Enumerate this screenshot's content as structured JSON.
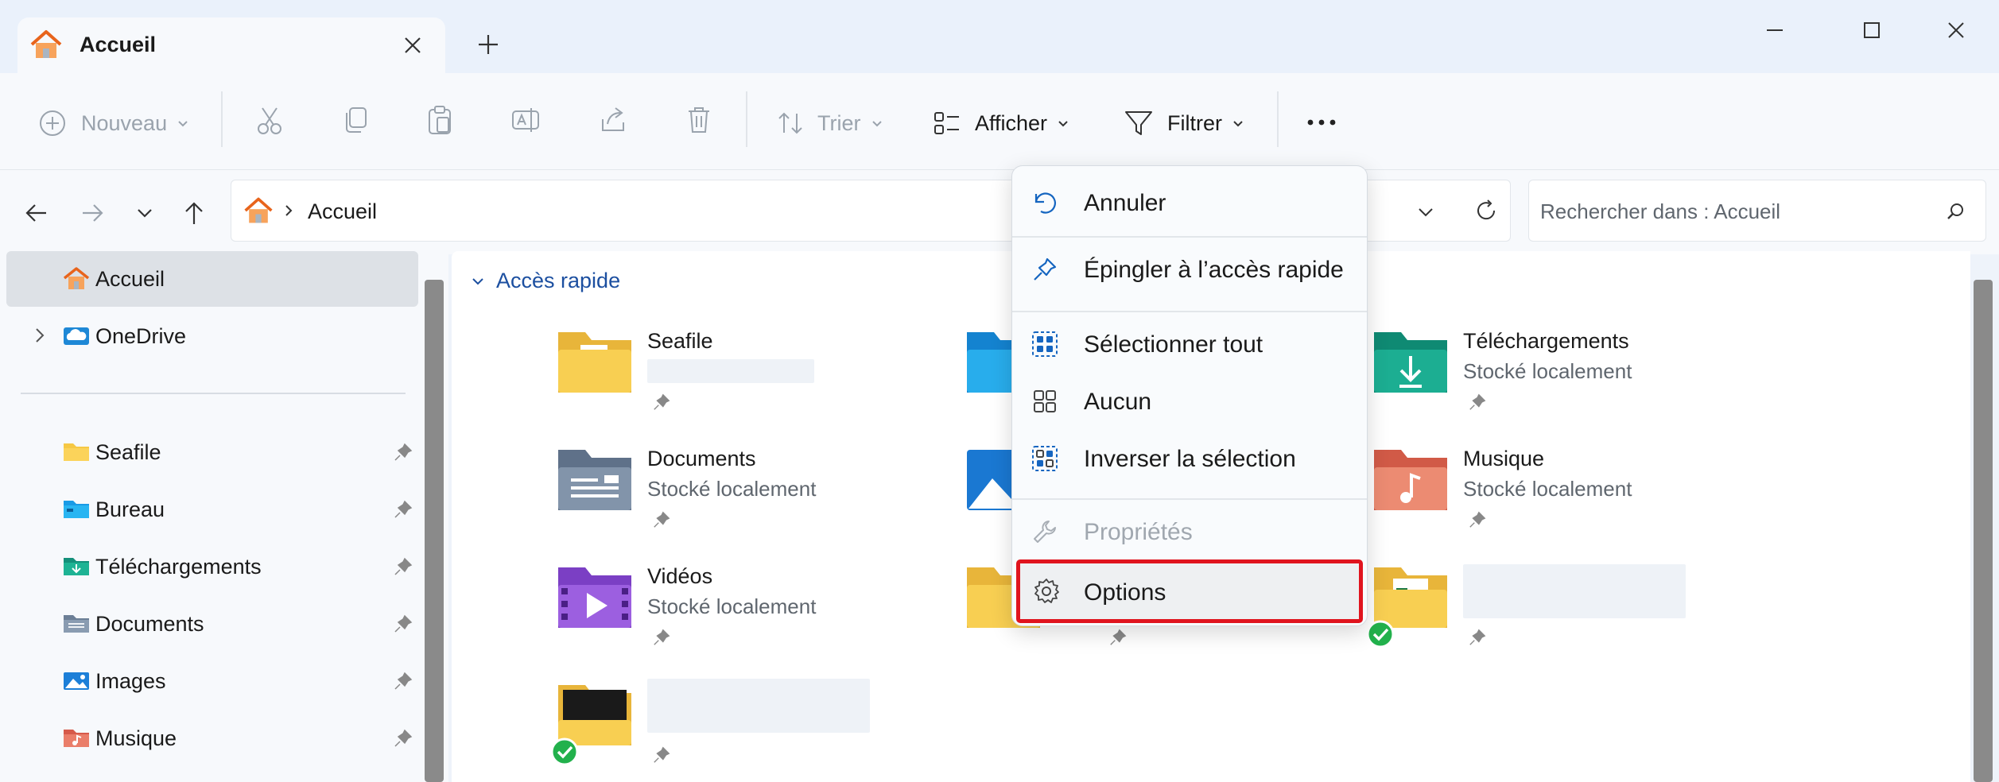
{
  "tab": {
    "title": "Accueil",
    "new_tab": "+"
  },
  "toolbar": {
    "new_label": "Nouveau",
    "sort_label": "Trier",
    "view_label": "Afficher",
    "filter_label": "Filtrer"
  },
  "address": {
    "breadcrumb": [
      "Accueil"
    ],
    "search_placeholder": "Rechercher dans : Accueil"
  },
  "sidebar": {
    "items": [
      {
        "label": "Accueil",
        "icon": "home-icon",
        "active": true
      },
      {
        "label": "OneDrive",
        "icon": "onedrive-icon",
        "expandable": true
      },
      {
        "label": "Seafile",
        "icon": "folder-icon",
        "pinned": true
      },
      {
        "label": "Bureau",
        "icon": "desktop-folder-icon",
        "pinned": true
      },
      {
        "label": "Téléchargements",
        "icon": "downloads-folder-icon",
        "pinned": true
      },
      {
        "label": "Documents",
        "icon": "documents-folder-icon",
        "pinned": true
      },
      {
        "label": "Images",
        "icon": "pictures-folder-icon",
        "pinned": true
      },
      {
        "label": "Musique",
        "icon": "music-folder-icon",
        "pinned": true
      }
    ]
  },
  "quick_access": {
    "heading": "Accès rapide",
    "items": [
      {
        "name": "Seafile",
        "subtitle": ""
      },
      {
        "name": "Téléchargements",
        "subtitle": "Stocké localement"
      },
      {
        "name": "Documents",
        "subtitle": "Stocké localement"
      },
      {
        "name": "Musique",
        "subtitle": "Stocké localement"
      },
      {
        "name": "Vidéos",
        "subtitle": "Stocké localement"
      }
    ]
  },
  "context_menu": {
    "items": [
      {
        "label": "Annuler",
        "icon": "undo-icon"
      },
      {
        "label": "Épingler à l’accès rapide",
        "icon": "pin-icon"
      },
      {
        "label": "Sélectionner tout",
        "icon": "select-all-icon"
      },
      {
        "label": "Aucun",
        "icon": "select-none-icon"
      },
      {
        "label": "Inverser la sélection",
        "icon": "invert-selection-icon"
      },
      {
        "label": "Propriétés",
        "icon": "wrench-icon",
        "disabled": true
      },
      {
        "label": "Options",
        "icon": "gear-icon",
        "highlighted": true
      }
    ]
  },
  "colors": {
    "accent": "#1c4fa0",
    "highlight_border": "#e0141e",
    "folder_yellow": "#f6c844"
  }
}
